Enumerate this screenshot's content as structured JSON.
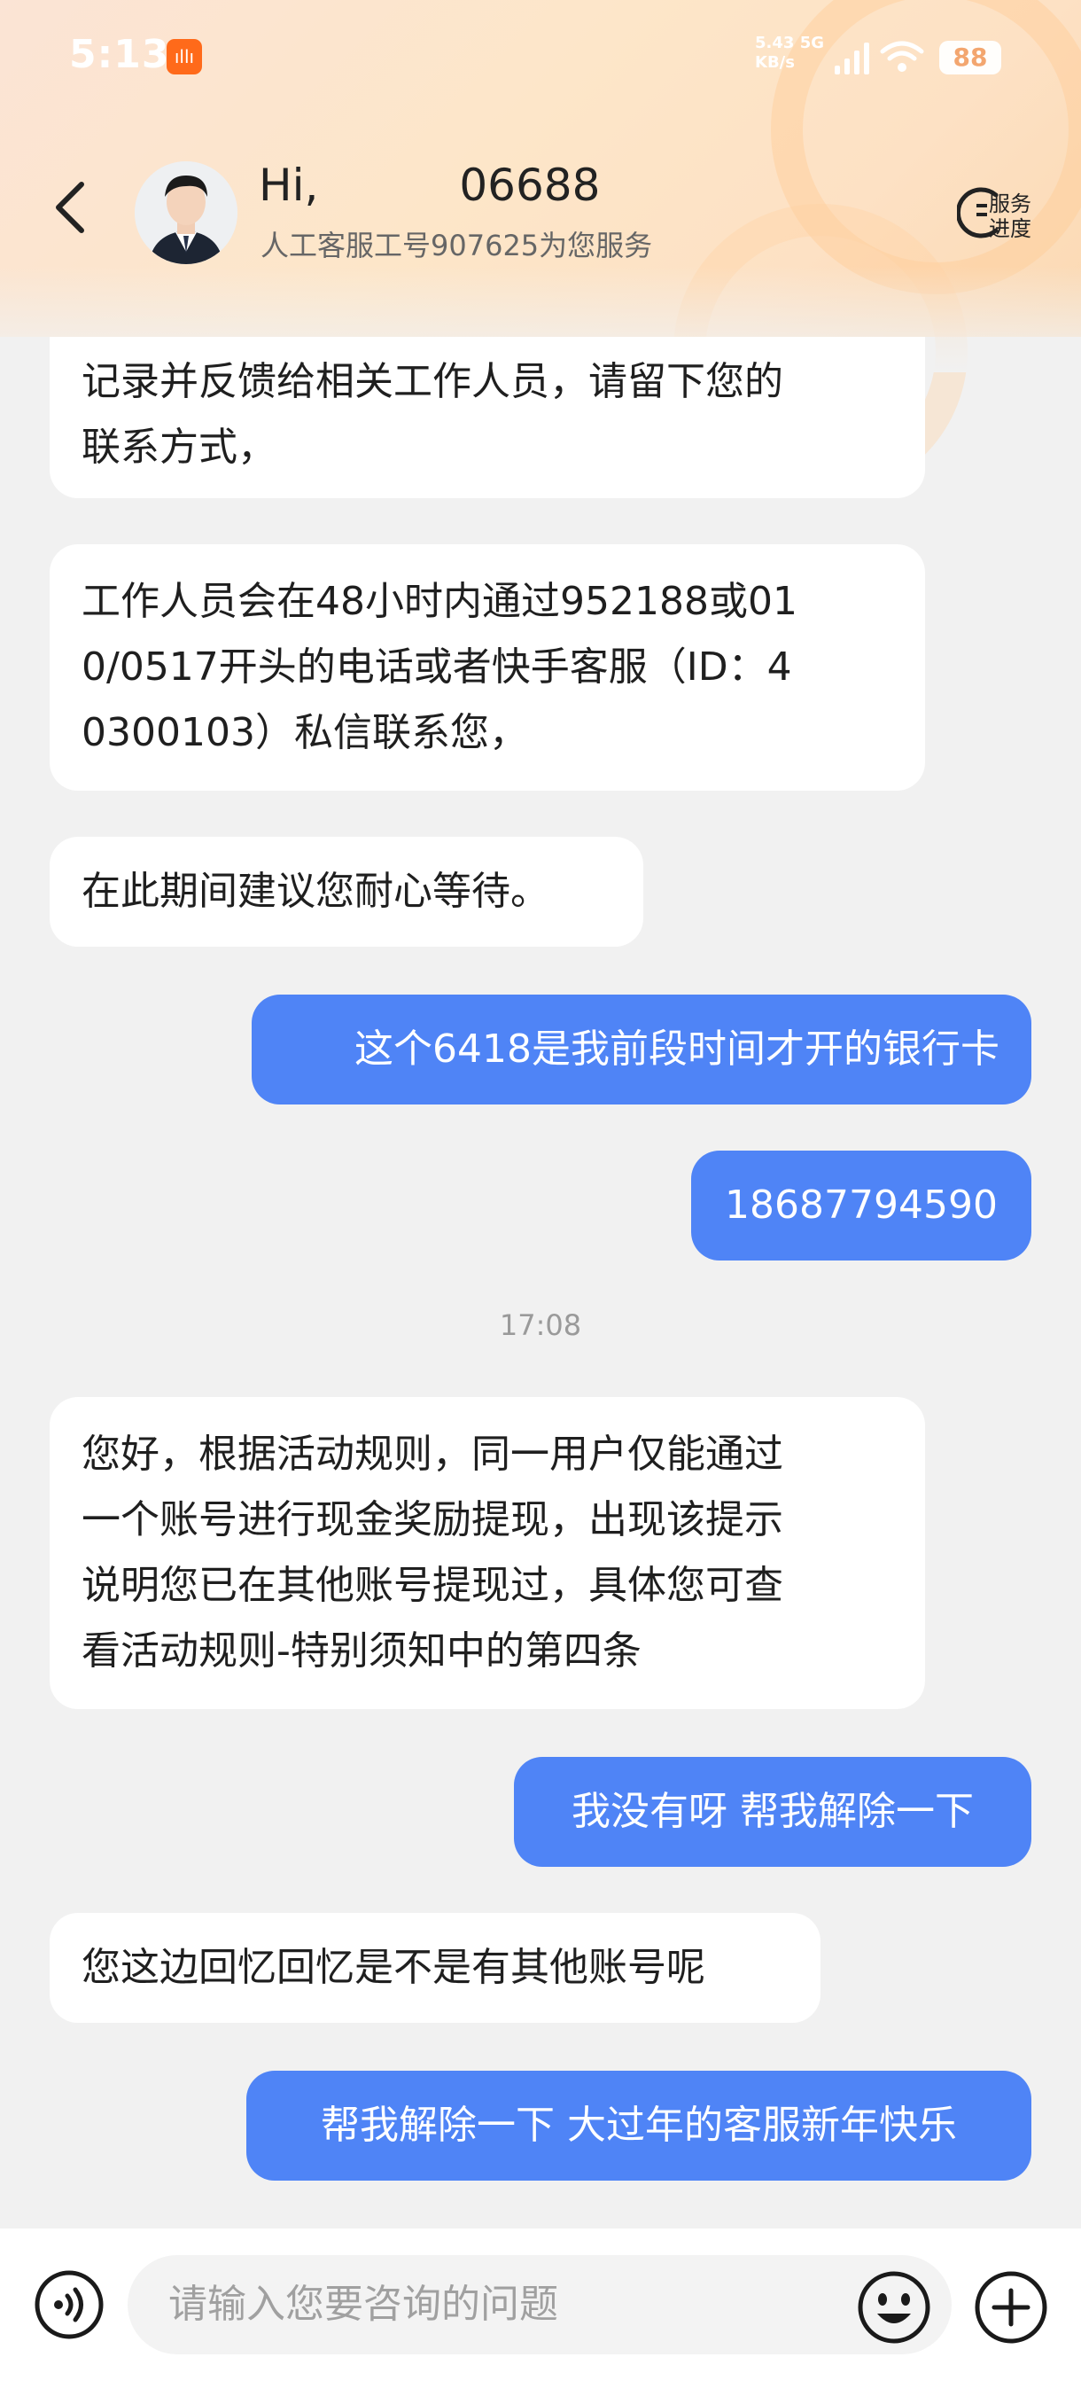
{
  "status_bar": {
    "time": "5:13",
    "app_badge": "ıllı",
    "net_speed_value": "5.43",
    "net_speed_type": "5G",
    "net_speed_unit": "KB/s",
    "battery": "88"
  },
  "header": {
    "greeting": "Hi,          06688",
    "subtitle": "人工客服工号907625为您服务",
    "service_progress_line1": "服务",
    "service_progress_line2": "进度"
  },
  "messages": [
    {
      "sender": "agent",
      "lines": [
        "记录并反馈给相关工作人员，请留下您的",
        "联系方式，"
      ]
    },
    {
      "sender": "agent",
      "lines": [
        "工作人员会在48小时内通过952188或01",
        "0/0517开头的电话或者快手客服（ID：4",
        "0300103）私信联系您，"
      ]
    },
    {
      "sender": "agent",
      "lines": [
        "在此期间建议您耐心等待。"
      ]
    },
    {
      "sender": "user",
      "lines": [
        "这个6418是我前段时间才开的银行卡"
      ]
    },
    {
      "sender": "user",
      "lines": [
        "18687794590"
      ]
    },
    {
      "sender": "agent",
      "lines": [
        "您好，根据活动规则，同一用户仅能通过",
        "一个账号进行现金奖励提现，出现该提示",
        "说明您已在其他账号提现过，具体您可查",
        "看活动规则-特别须知中的第四条"
      ]
    },
    {
      "sender": "user",
      "lines": [
        "我没有呀 帮我解除一下"
      ]
    },
    {
      "sender": "agent",
      "lines": [
        "您这边回忆回忆是不是有其他账号呢"
      ]
    },
    {
      "sender": "user",
      "lines": [
        "帮我解除一下 大过年的客服新年快乐"
      ]
    }
  ],
  "timestamp": "17:08",
  "input": {
    "placeholder": "请输入您要咨询的问题"
  },
  "colors": {
    "user_bubble": "#4f84f6",
    "agent_bubble": "#ffffff",
    "background": "#f1f1f1"
  },
  "icons": {
    "back": "chevron-left-icon",
    "voice": "voice-icon",
    "emoji": "emoji-icon",
    "plus": "plus-icon",
    "progress": "progress-icon"
  }
}
